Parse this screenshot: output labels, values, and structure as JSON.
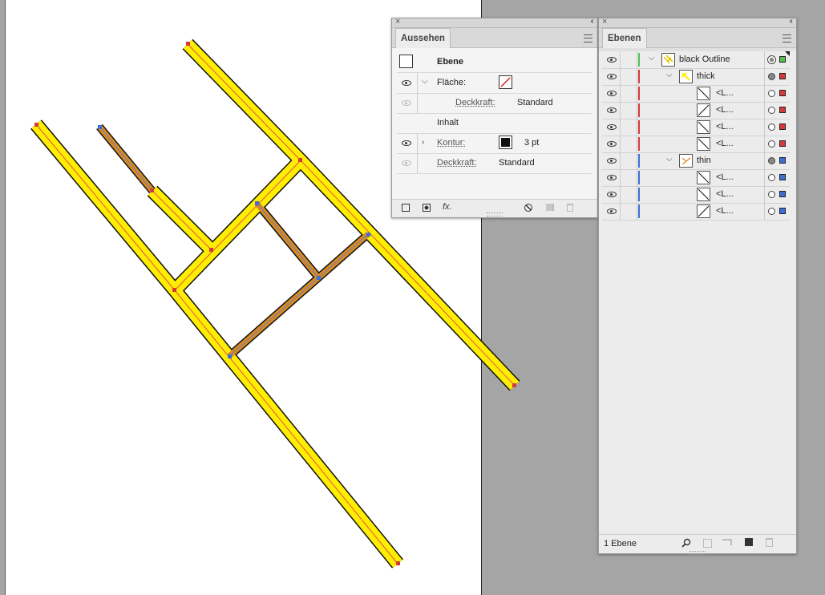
{
  "colors": {
    "artboard": "#ffffff",
    "pasteboard": "#a5a5a5",
    "yellow": "#ffee00",
    "orange": "#d88a1f",
    "red_layer": "#d6393b",
    "blue_layer": "#3c6fd6",
    "green_layer": "#4fc24f"
  },
  "appearance_panel": {
    "tab": "Aussehen",
    "close_glyph": "×",
    "collapse_glyph": "‹‹",
    "header": "Ebene",
    "fill_label": "Fläche:",
    "fill_opacity_label": "Deckkraft:",
    "fill_opacity_value": "Standard",
    "content_label": "Inhalt",
    "stroke_label": "Kontur:",
    "stroke_weight": "3 pt",
    "opacity_label": "Deckkraft:",
    "opacity_value": "Standard",
    "fx_label": "fx."
  },
  "layers_panel": {
    "tab": "Ebenen",
    "close_glyph": "×",
    "collapse_glyph": "‹‹",
    "rows": [
      {
        "name": "black Outline",
        "depth": 0,
        "bar": "#4fc24f",
        "sq": "#4fc24f",
        "twisty": "open",
        "target": "double",
        "thumb": "group"
      },
      {
        "name": "thick",
        "depth": 1,
        "bar": "#d6393b",
        "sq": "#d6393b",
        "twisty": "open",
        "target": "filled",
        "thumb": "yellow"
      },
      {
        "name": "<L...",
        "depth": 2,
        "bar": "#d6393b",
        "sq": "#d6393b",
        "twisty": "",
        "target": "empty",
        "thumb": "diag-down"
      },
      {
        "name": "<L...",
        "depth": 2,
        "bar": "#d6393b",
        "sq": "#d6393b",
        "twisty": "",
        "target": "empty",
        "thumb": "diag-up"
      },
      {
        "name": "<L...",
        "depth": 2,
        "bar": "#d6393b",
        "sq": "#d6393b",
        "twisty": "",
        "target": "empty",
        "thumb": "diag-down"
      },
      {
        "name": "<L...",
        "depth": 2,
        "bar": "#d6393b",
        "sq": "#d6393b",
        "twisty": "",
        "target": "empty",
        "thumb": "diag-down"
      },
      {
        "name": "thin",
        "depth": 1,
        "bar": "#3c6fd6",
        "sq": "#3c6fd6",
        "twisty": "open",
        "target": "filled",
        "thumb": "orange"
      },
      {
        "name": "<L...",
        "depth": 2,
        "bar": "#3c6fd6",
        "sq": "#3c6fd6",
        "twisty": "",
        "target": "empty",
        "thumb": "diag-down"
      },
      {
        "name": "<L...",
        "depth": 2,
        "bar": "#3c6fd6",
        "sq": "#3c6fd6",
        "twisty": "",
        "target": "empty",
        "thumb": "diag-down"
      },
      {
        "name": "<L...",
        "depth": 2,
        "bar": "#3c6fd6",
        "sq": "#3c6fd6",
        "twisty": "",
        "target": "empty",
        "thumb": "diag-up"
      }
    ],
    "footer_label": "1 Ebene"
  }
}
